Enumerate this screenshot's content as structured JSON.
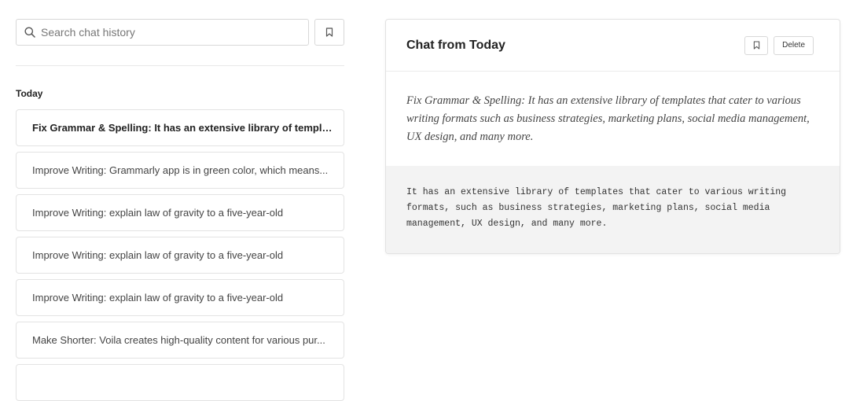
{
  "search": {
    "placeholder": "Search chat history"
  },
  "history": {
    "section_label": "Today",
    "items": [
      {
        "label": "Fix Grammar & Spelling: It has an extensive library of templat..."
      },
      {
        "label": "Improve Writing: Grammarly app is in green color, which means..."
      },
      {
        "label": "Improve Writing: explain law of gravity to a five-year-old"
      },
      {
        "label": "Improve Writing: explain law of gravity to a five-year-old"
      },
      {
        "label": "Improve Writing: explain law of gravity to a five-year-old"
      },
      {
        "label": "Make Shorter: Voila creates high-quality content for various pur..."
      }
    ]
  },
  "chat": {
    "title": "Chat from Today",
    "delete_label": "Delete",
    "prompt": "Fix Grammar & Spelling: It has an extensive library of templates that cater to various writing formats such as business strategies, marketing plans, social media management, UX design, and many more.",
    "response": "It has an extensive library of templates that cater to various writing formats, such as business strategies, marketing plans, social media management, UX design, and many more."
  },
  "icons": {
    "search": "search-icon",
    "bookmark": "bookmark-icon"
  }
}
